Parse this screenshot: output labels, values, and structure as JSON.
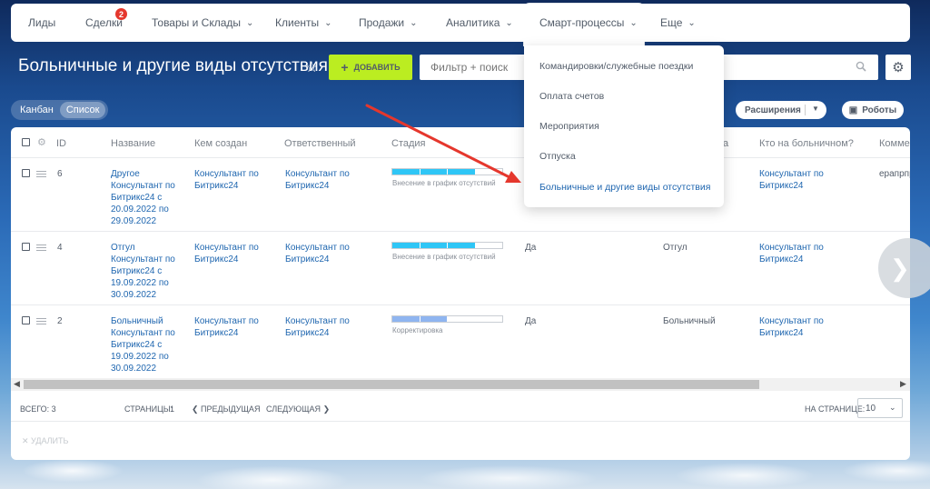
{
  "nav": {
    "items": [
      {
        "label": "Лиды",
        "chevron": false
      },
      {
        "label": "Сделки",
        "chevron": false,
        "badge": "2"
      },
      {
        "label": "Товары и Склады",
        "chevron": true
      },
      {
        "label": "Клиенты",
        "chevron": true
      },
      {
        "label": "Продажи",
        "chevron": true
      },
      {
        "label": "Аналитика",
        "chevron": true
      },
      {
        "label": "Смарт-процессы",
        "chevron": true,
        "active": true
      },
      {
        "label": "Еще",
        "chevron": true
      }
    ]
  },
  "header": {
    "title": "Больничные и другие виды отсутствия",
    "add_label": "ДОБАВИТЬ",
    "filter_placeholder": "Фильтр + поиск"
  },
  "views": {
    "kanban": "Канбан",
    "list": "Список"
  },
  "toolbar": {
    "extensions": "Расширения",
    "robots": "Роботы"
  },
  "table": {
    "columns": [
      "ID",
      "Название",
      "Кем создан",
      "Ответственный",
      "Стадия",
      "Кто на больничном?",
      "Комме"
    ],
    "hidden_col_fragment": "а",
    "rows": [
      {
        "id": "6",
        "name": [
          "Другое",
          "Консультант по",
          "Битрикс24 с",
          "20.09.2022 по",
          "29.09.2022"
        ],
        "created_by": [
          "Консультант по",
          "Битрикс24"
        ],
        "responsible": [
          "Консультант по",
          "Битрикс24"
        ],
        "stage_label": "Внесение в график отсутствий",
        "stage_filled": 3,
        "stage_color": "#2fc6f6",
        "col_yes": "",
        "type": "",
        "who": [
          "Консультант по",
          "Битрикс24"
        ],
        "comment": "ерапрпр"
      },
      {
        "id": "4",
        "name": [
          "Отгул",
          "Консультант по",
          "Битрикс24 с",
          "19.09.2022 по",
          "30.09.2022"
        ],
        "created_by": [
          "Консультант по",
          "Битрикс24"
        ],
        "responsible": [
          "Консультант по",
          "Битрикс24"
        ],
        "stage_label": "Внесение в график отсутствий",
        "stage_filled": 3,
        "stage_color": "#2fc6f6",
        "col_yes": "Да",
        "type": "Отгул",
        "who": [
          "Консультант по",
          "Битрикс24"
        ],
        "comment": ""
      },
      {
        "id": "2",
        "name": [
          "Больничный",
          "Консультант по",
          "Битрикс24 с",
          "19.09.2022 по",
          "30.09.2022"
        ],
        "created_by": [
          "Консультант по",
          "Битрикс24"
        ],
        "responsible": [
          "Консультант по",
          "Битрикс24"
        ],
        "stage_label": "Корректировка",
        "stage_filled": 2,
        "stage_color": "#8fb5f0",
        "col_yes": "Да",
        "type": "Больничный",
        "who": [
          "Консультант по",
          "Битрикс24"
        ],
        "comment": ""
      }
    ]
  },
  "footer": {
    "total": "ВСЕГО: 3",
    "pages": "СТРАНИЦЫ:",
    "page_num": "1",
    "prev": "ПРЕДЫДУЩАЯ",
    "next": "СЛЕДУЮЩАЯ",
    "per_page_label": "НА СТРАНИЦЕ:",
    "per_page_value": "10",
    "delete": "УДАЛИТЬ"
  },
  "dropdown": {
    "items": [
      "Командировки/служебные поездки",
      "Оплата счетов",
      "Мероприятия",
      "Отпуска",
      "Больничные и другие виды отсутствия"
    ],
    "active_index": 4
  },
  "colors": {
    "accent": "#2067b0",
    "add_button": "#bbed21",
    "annotation_arrow": "#e5372d"
  }
}
